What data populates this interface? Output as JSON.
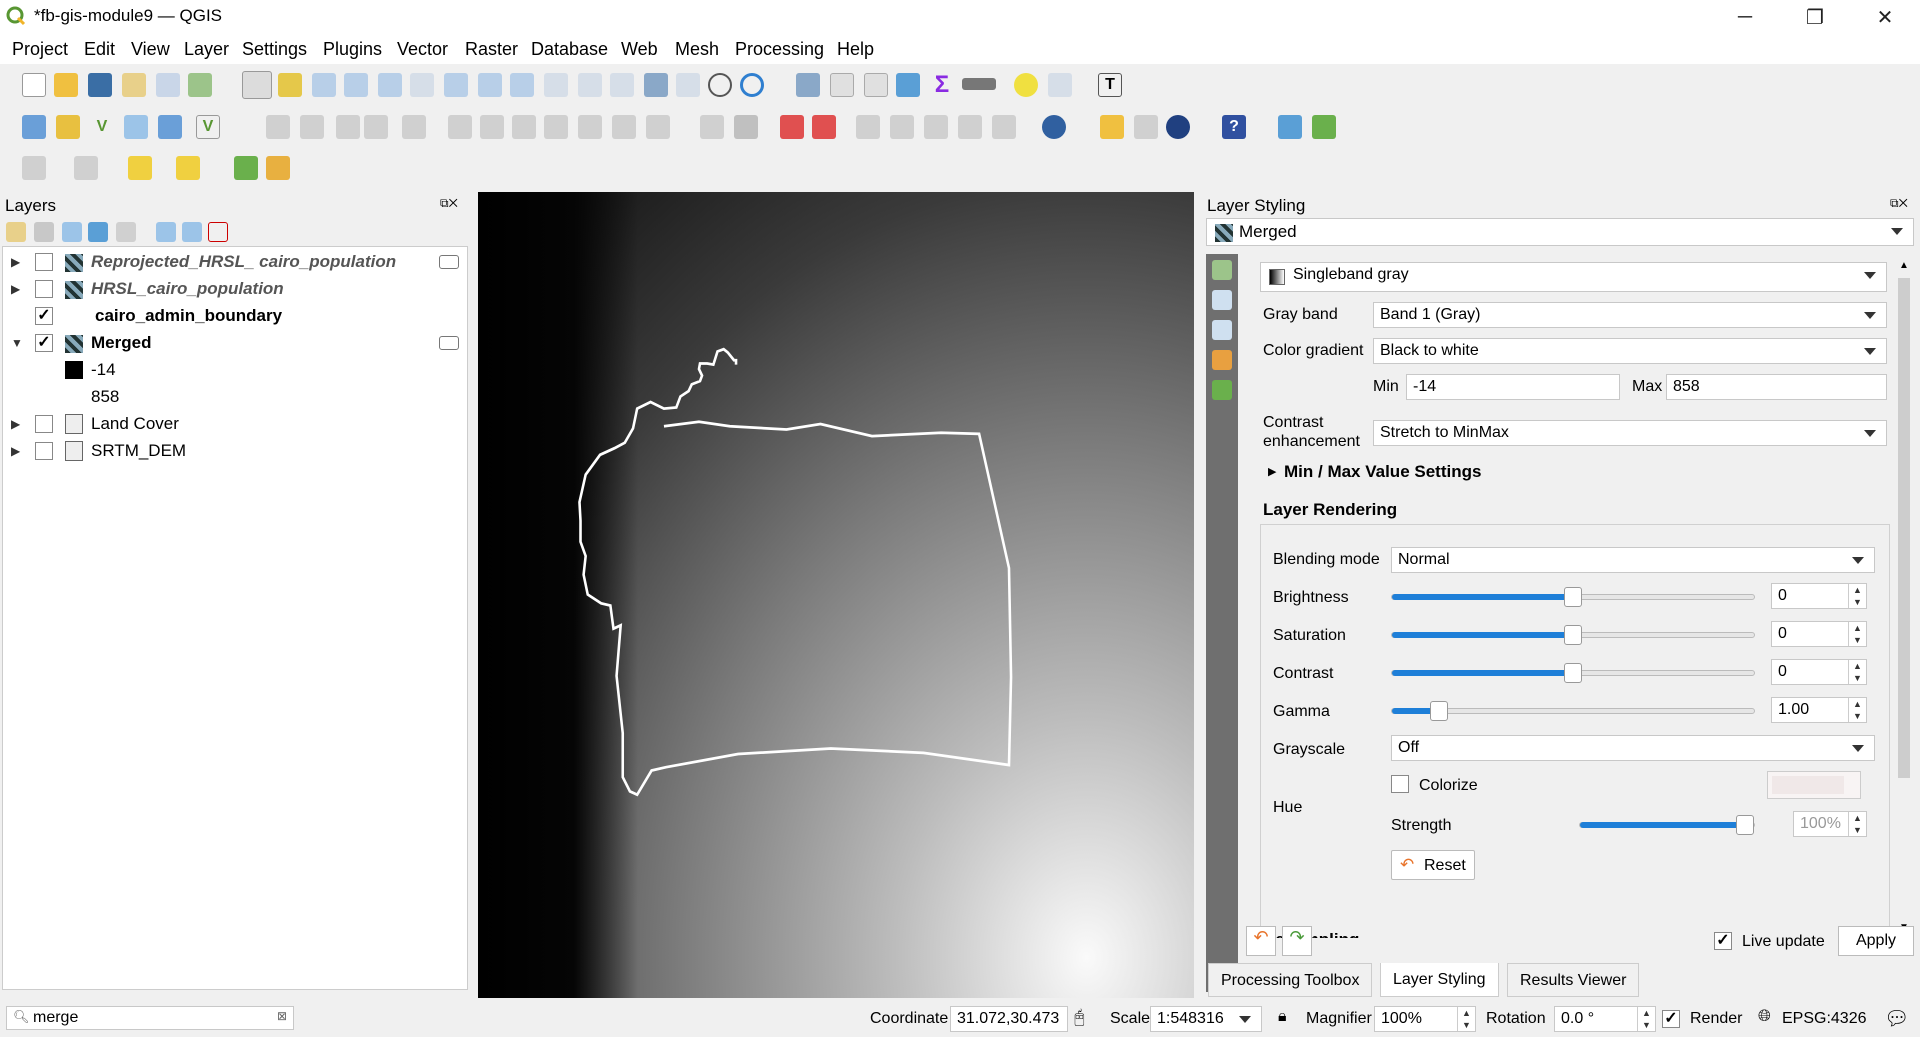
{
  "window": {
    "title": "*fb-gis-module9 — QGIS",
    "minimize": "─",
    "restore": "❐",
    "close": "✕"
  },
  "menu": [
    "Project",
    "Edit",
    "View",
    "Layer",
    "Settings",
    "Plugins",
    "Vector",
    "Raster",
    "Database",
    "Web",
    "Mesh",
    "Processing",
    "Help"
  ],
  "layers_panel": {
    "title": "Layers",
    "items": [
      {
        "name": "Reprojected_HRSL_ cairo_population",
        "checked": false,
        "style": "italic-bold"
      },
      {
        "name": "HRSL_cairo_population",
        "checked": false,
        "style": "italic-bold"
      },
      {
        "name": "cairo_admin_boundary",
        "checked": true,
        "style": "bold"
      },
      {
        "name": "Merged",
        "checked": true,
        "style": "bold"
      },
      {
        "name": "-14"
      },
      {
        "name": "858"
      },
      {
        "name": "Land Cover",
        "checked": false
      },
      {
        "name": "SRTM_DEM",
        "checked": false
      }
    ],
    "checkmark": "✓"
  },
  "styling": {
    "title": "Layer Styling",
    "layer": "Merged",
    "renderer": "Singleband gray",
    "gray_band_label": "Gray band",
    "gray_band": "Band 1 (Gray)",
    "color_gradient_label": "Color gradient",
    "color_gradient": "Black to white",
    "min_label": "Min",
    "min": "-14",
    "max_label": "Max",
    "max": "858",
    "contrast_label_1": "Contrast",
    "contrast_label_2": "enhancement",
    "contrast": "Stretch to MinMax",
    "minmax_settings": "Min / Max Value Settings",
    "layer_rendering": "Layer Rendering",
    "blending_label": "Blending mode",
    "blending": "Normal",
    "brightness_label": "Brightness",
    "brightness": "0",
    "saturation_label": "Saturation",
    "saturation": "0",
    "contrast_s_label": "Contrast",
    "contrast_s": "0",
    "gamma_label": "Gamma",
    "gamma": "1.00",
    "grayscale_label": "Grayscale",
    "grayscale": "Off",
    "hue_label": "Hue",
    "colorize_label": "Colorize",
    "strength_label": "Strength",
    "strength": "100%",
    "reset": "Reset",
    "resampling": "Resampling",
    "live_update": "Live update",
    "apply": "Apply",
    "levels": {
      "brightness": 0.5,
      "saturation": 0.5,
      "contrast": 0.5,
      "gamma": 0.11,
      "strength": 1.0
    }
  },
  "tabs": [
    "Processing Toolbox",
    "Layer Styling",
    "Results Viewer"
  ],
  "status": {
    "search": "merge",
    "coordinate_label": "Coordinate",
    "coordinate": "31.072,30.473",
    "scale_label": "Scale",
    "scale": "1:548316",
    "magnifier_label": "Magnifier",
    "magnifier": "100%",
    "rotation_label": "Rotation",
    "rotation": "0.0 °",
    "render_label": "Render",
    "crs": "EPSG:4326"
  },
  "colors": {
    "accent": "#1e7fd8",
    "qgis_green": "#589632"
  }
}
